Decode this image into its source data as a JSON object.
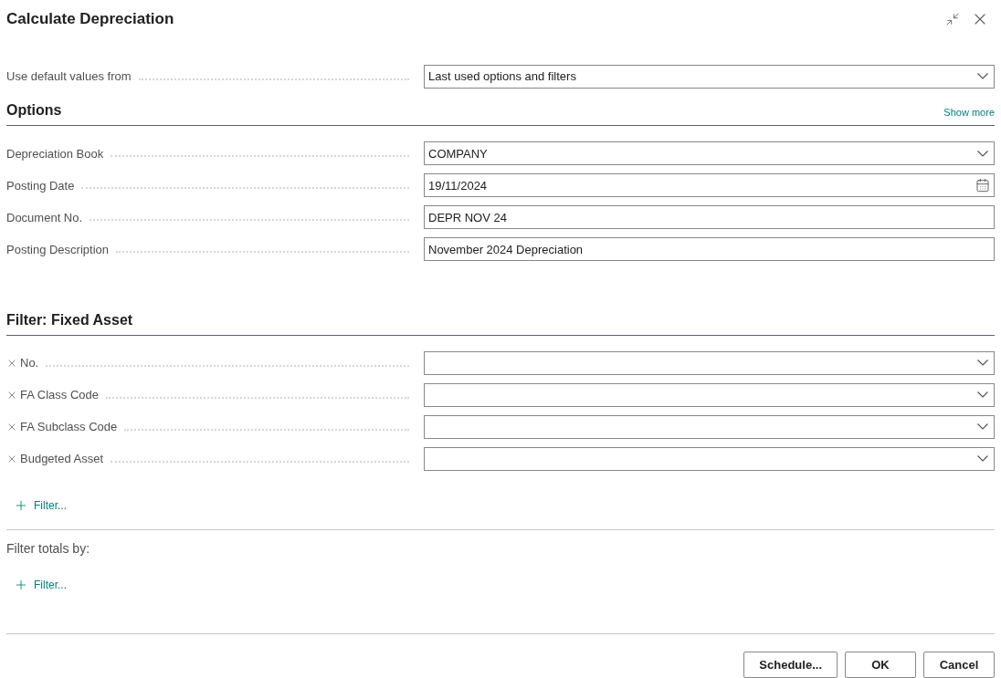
{
  "window": {
    "title": "Calculate Depreciation"
  },
  "defaults": {
    "label": "Use default values from",
    "value": "Last used options and filters",
    "kind": "dropdown"
  },
  "options": {
    "title": "Options",
    "show_more": "Show more",
    "fields": [
      {
        "label": "Depreciation Book",
        "value": "COMPANY",
        "kind": "dropdown"
      },
      {
        "label": "Posting Date",
        "value": "19/11/2024",
        "kind": "date"
      },
      {
        "label": "Document No.",
        "value": "DEPR NOV 24",
        "kind": "text"
      },
      {
        "label": "Posting Description",
        "value": "November 2024 Depreciation",
        "kind": "text"
      }
    ]
  },
  "filter": {
    "title": "Filter: Fixed Asset",
    "fields": [
      {
        "label": "No.",
        "kind": "dropdown"
      },
      {
        "label": "FA Class Code",
        "kind": "dropdown"
      },
      {
        "label": "FA Subclass Code",
        "kind": "dropdown"
      },
      {
        "label": "Budgeted Asset",
        "kind": "dropdown"
      }
    ],
    "add_filter": "Filter..."
  },
  "totals": {
    "label": "Filter totals by:",
    "add_filter": "Filter..."
  },
  "buttons": [
    "Schedule...",
    "OK",
    "Cancel"
  ]
}
